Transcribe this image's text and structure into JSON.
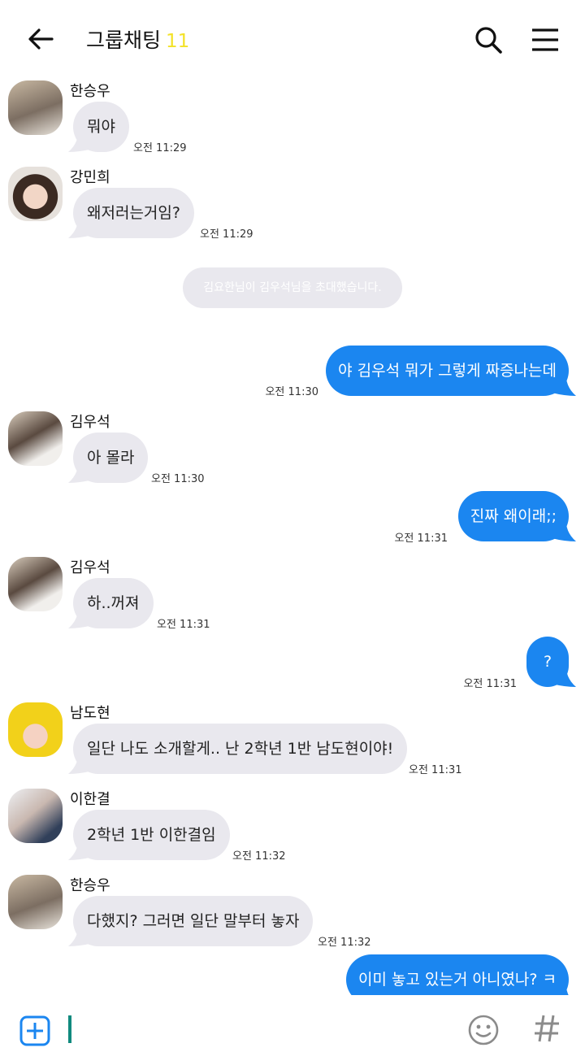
{
  "header": {
    "title": "그룹채팅",
    "member_count": "11"
  },
  "system_message": "김요한님이 김우석님을 초대했습니다.",
  "messages": [
    {
      "sender": "한승우",
      "text": "뭐야",
      "time": "오전 11:29"
    },
    {
      "sender": "강민희",
      "text": "왜저러는거임?",
      "time": "오전 11:29"
    },
    {
      "sender": "me",
      "text": "야 김우석 뭐가 그렇게 짜증나는데",
      "time": "오전 11:30"
    },
    {
      "sender": "김우석",
      "text": "아 몰라",
      "time": "오전 11:30"
    },
    {
      "sender": "me",
      "text": "진짜 왜이래;;",
      "time": "오전 11:31"
    },
    {
      "sender": "김우석",
      "text": "하..꺼져",
      "time": "오전 11:31"
    },
    {
      "sender": "me",
      "text": "?",
      "time": "오전 11:31"
    },
    {
      "sender": "남도현",
      "text": "일단 나도 소개할게.. 난 2학년 1반 남도현이야!",
      "time": "오전 11:31"
    },
    {
      "sender": "이한결",
      "text": "2학년 1반 이한결임",
      "time": "오전 11:32"
    },
    {
      "sender": "한승우",
      "text": "다했지? 그러면 일단 말부터 놓자",
      "time": "오전 11:32"
    },
    {
      "sender": "me",
      "text": "이미 놓고 있는거 아니였나? ㅋ",
      "time": ""
    }
  ],
  "icons": {
    "back": "back-arrow-icon",
    "search": "search-icon",
    "menu": "menu-icon",
    "add": "add-plus-icon",
    "emoji": "emoji-icon",
    "hashtag": "hashtag-icon"
  },
  "colors": {
    "outgoing_bubble": "#1b86f0",
    "incoming_bubble": "#e9e8ee",
    "member_count": "#f3e227",
    "caret": "#118a7e"
  }
}
